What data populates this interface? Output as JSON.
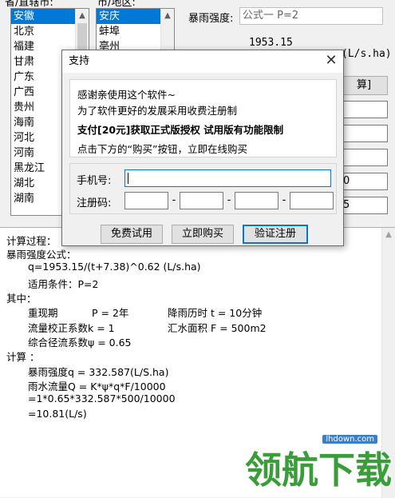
{
  "header": {
    "col1_label": "省/直辖市:",
    "col2_label": "市/地区:",
    "rain_formula_label": "暴雨强度:",
    "formula_select_value": "公式一 P=2",
    "formula_value_text": "1953.15",
    "unit_text": "(L/s.ha)"
  },
  "province_list": [
    {
      "label": "安徽",
      "selected": true
    },
    {
      "label": "北京",
      "selected": false
    },
    {
      "label": "福建",
      "selected": false
    },
    {
      "label": "甘肃",
      "selected": false
    },
    {
      "label": "广东",
      "selected": false
    },
    {
      "label": "广西",
      "selected": false
    },
    {
      "label": "贵州",
      "selected": false
    },
    {
      "label": "海南",
      "selected": false
    },
    {
      "label": "河北",
      "selected": false
    },
    {
      "label": "河南",
      "selected": false
    },
    {
      "label": "黑龙江",
      "selected": false
    },
    {
      "label": "湖北",
      "selected": false
    },
    {
      "label": "湖南",
      "selected": false
    }
  ],
  "city_list": [
    {
      "label": "安庆",
      "selected": true
    },
    {
      "label": "蚌埠",
      "selected": false
    },
    {
      "label": "亳州",
      "selected": false
    }
  ],
  "right_panel": {
    "calc_button_partial": "算]",
    "field_a_partial": "",
    "field_b_partial": "",
    "field_c_partial": "0",
    "field_d_partial": "5"
  },
  "dialog": {
    "title": "支持",
    "msg_line1": "感谢亲使用这个软件~",
    "msg_line2": "为了软件更好的发展采用收费注册制",
    "msg_line3": "支付[20元]获取正式版授权 试用版有功能限制",
    "msg_line4": "点击下方的“购买”按钮，立即在线购买",
    "phone_label": "手机号:",
    "phone_value": "",
    "regcode_label": "注册码:",
    "regcode_sep": "-",
    "btn_trial": "免费试用",
    "btn_buy": "立即购买",
    "btn_verify": "验证注册"
  },
  "calc": {
    "lines": [
      "计算过程：",
      "暴雨强度公式：",
      "q=1953.15/(t+7.38)^0.62 (L/s.ha)",
      "适用条件：P=2",
      "其中：",
      "重现期",
      "P = 2年",
      "降雨历时 t = 10分钟",
      "流量校正系数k = 1",
      "汇水面积 F = 500m2",
      "综合径流系数ψ = 0.65",
      "计算 ：",
      "暴雨强度q = 332.587(L/S.ha)",
      "雨水流量Q = K*ψ*q*F/10000",
      "=1*0.65*332.587*500/10000",
      "=10.81(L/s)"
    ]
  },
  "watermark": {
    "text": "领航下载",
    "domain": "lhdown.com"
  }
}
